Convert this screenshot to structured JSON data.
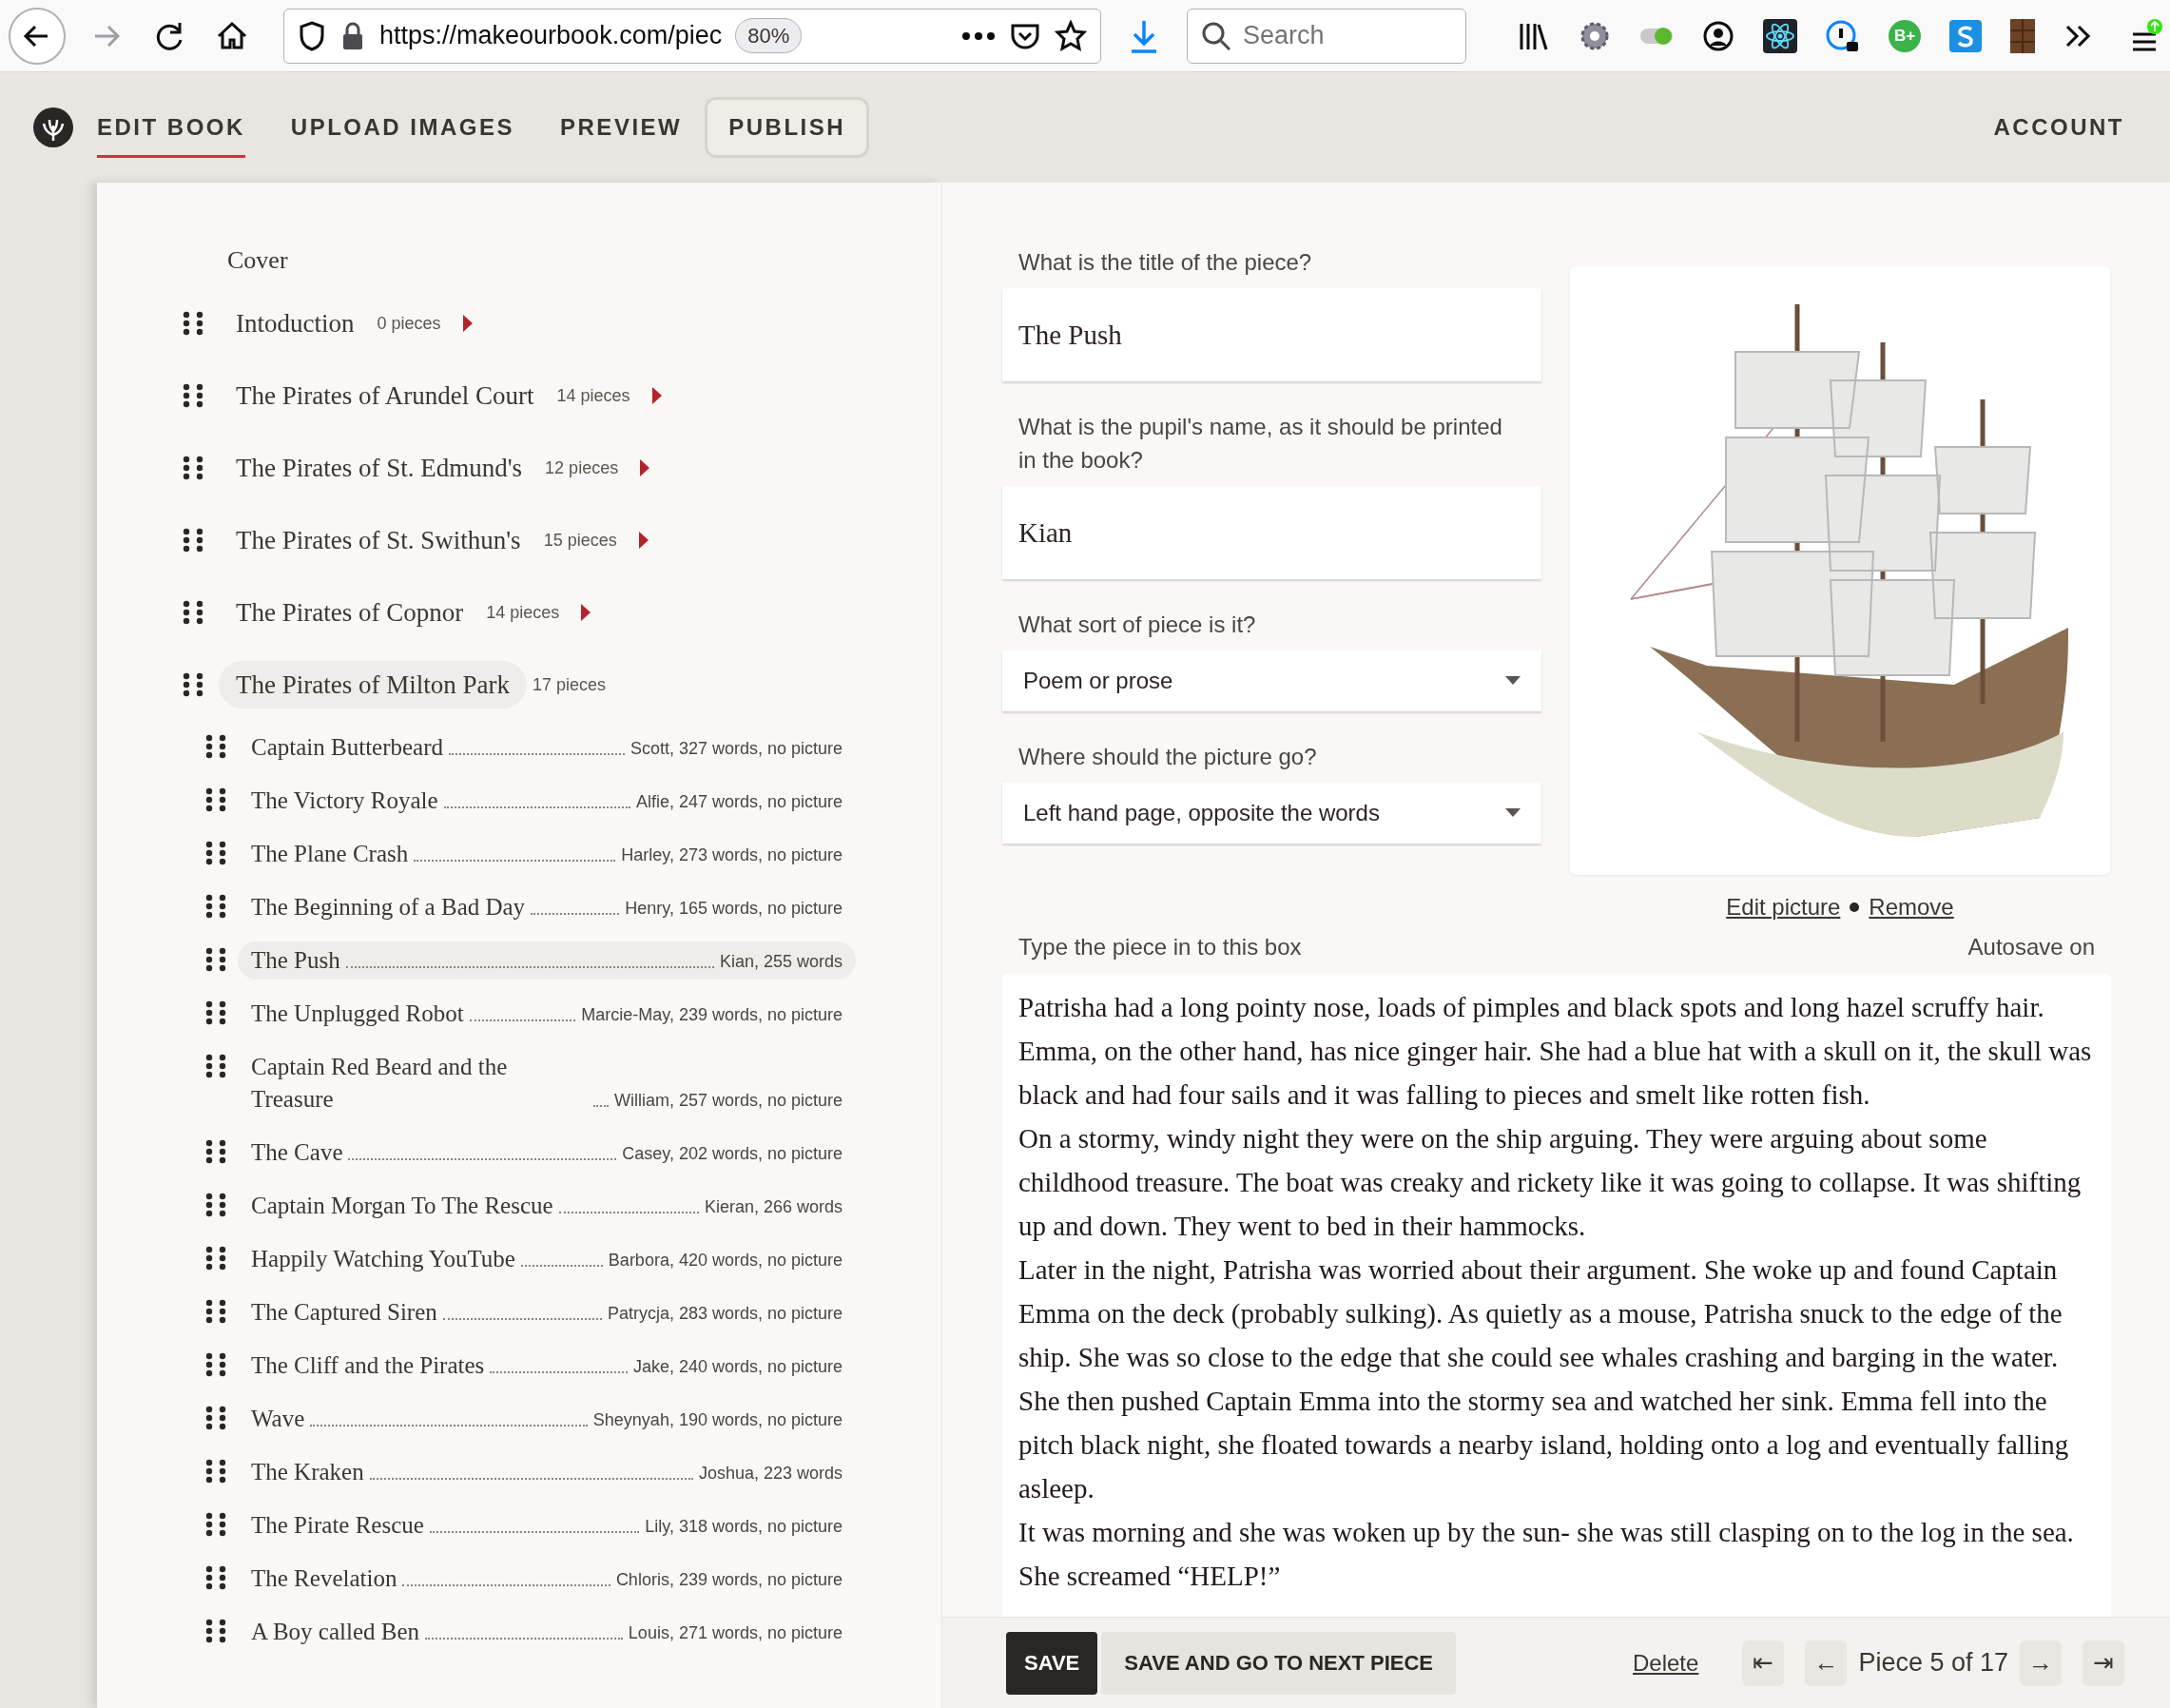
{
  "browser": {
    "url": "https://makeourbook.com/piec",
    "zoom": "80%",
    "search_placeholder": "Search",
    "extension_badge": "B+"
  },
  "nav": {
    "tabs": [
      {
        "label": "EDIT BOOK",
        "kind": "tab",
        "selected": true
      },
      {
        "label": "UPLOAD IMAGES",
        "kind": "tab",
        "selected": false
      },
      {
        "label": "PREVIEW",
        "kind": "tab",
        "selected": false
      },
      {
        "label": "PUBLISH",
        "kind": "button",
        "selected": false
      }
    ],
    "account": "ACCOUNT"
  },
  "contents": [
    {
      "kind": "cover",
      "title": "Cover"
    },
    {
      "kind": "chapter",
      "title": "Intoduction",
      "count": "0 pieces",
      "expanded": false,
      "selected": false
    },
    {
      "kind": "chapter",
      "title": "The Pirates of Arundel Court",
      "count": "14 pieces",
      "expanded": false,
      "selected": false
    },
    {
      "kind": "chapter",
      "title": "The Pirates of St. Edmund's",
      "count": "12 pieces",
      "expanded": false,
      "selected": false
    },
    {
      "kind": "chapter",
      "title": "The Pirates of St. Swithun's",
      "count": "15 pieces",
      "expanded": false,
      "selected": false
    },
    {
      "kind": "chapter",
      "title": "The Pirates of Copnor",
      "count": "14 pieces",
      "expanded": false,
      "selected": false
    },
    {
      "kind": "chapter",
      "title": "The Pirates of Milton Park",
      "count": "17 pieces",
      "expanded": true,
      "selected": true,
      "children": [
        {
          "title": "Captain Butterbeard",
          "meta": "Scott, 327 words, no picture",
          "selected": false
        },
        {
          "title": "The Victory Royale",
          "meta": "Alfie, 247 words, no picture",
          "selected": false
        },
        {
          "title": "The Plane Crash",
          "meta": "Harley, 273 words, no picture",
          "selected": false
        },
        {
          "title": "The Beginning of a Bad Day",
          "meta": "Henry, 165 words, no picture",
          "selected": false
        },
        {
          "title": "The Push",
          "meta": "Kian, 255 words",
          "selected": true
        },
        {
          "title": "The Unplugged Robot",
          "meta": "Marcie-May, 239 words, no picture",
          "selected": false
        },
        {
          "title": "Captain Red Beard and the Treasure",
          "meta": "William, 257 words, no picture",
          "selected": false
        },
        {
          "title": "The Cave",
          "meta": "Casey, 202 words, no picture",
          "selected": false
        },
        {
          "title": "Captain Morgan To The Rescue",
          "meta": "Kieran, 266 words",
          "selected": false
        },
        {
          "title": "Happily Watching YouTube",
          "meta": "Barbora, 420 words, no picture",
          "selected": false
        },
        {
          "title": "The Captured Siren",
          "meta": "Patrycja, 283 words, no picture",
          "selected": false
        },
        {
          "title": "The Cliff and the Pirates",
          "meta": "Jake, 240 words, no picture",
          "selected": false
        },
        {
          "title": "Wave",
          "meta": "Sheynyah, 190 words, no picture",
          "selected": false
        },
        {
          "title": "The Kraken",
          "meta": "Joshua, 223 words",
          "selected": false
        },
        {
          "title": "The Pirate Rescue",
          "meta": "Lily, 318 words, no picture",
          "selected": false
        },
        {
          "title": "The Revelation",
          "meta": "Chloris, 239 words, no picture",
          "selected": false
        },
        {
          "title": "A Boy called Ben",
          "meta": "Louis, 271 words, no picture",
          "selected": false
        }
      ]
    }
  ],
  "form": {
    "fields": [
      {
        "kind": "text",
        "label": "What is the title of the piece?",
        "value": "The Push"
      },
      {
        "kind": "text",
        "label": "What is the pupil's name, as it should be printed in the book?",
        "value": "Kian"
      },
      {
        "kind": "select",
        "label": "What sort of piece is it?",
        "value": "Poem or prose"
      },
      {
        "kind": "select",
        "label": "Where should the picture go?",
        "value": "Left hand page, opposite the words"
      }
    ],
    "picture_links": [
      "Edit picture",
      "Remove"
    ],
    "text_label": "Type the piece in to this box",
    "autosave": "Autosave on",
    "text": [
      "Patrisha had a long pointy nose, loads of pimples and black spots and long hazel scruffy hair. Emma, on the other hand, has nice ginger hair. She had a blue hat with a skull on it, the skull was black and had four sails and it was falling to pieces and smelt like rotten fish.",
      "On a stormy, windy night they were on the ship arguing. They were arguing about some childhood treasure. The boat was creaky and rickety like it was going to collapse. It was shifting up and down. They went to bed in their hammocks.",
      "Later in the night, Patrisha was worried about their argument. She woke up and found Captain Emma on the deck (probably sulking). As quietly as a mouse, Patrisha snuck to the edge of the ship. She was so close to the edge that she could see whales crashing and barging in the water. She then pushed Captain Emma into the stormy sea and watched her sink.  Emma fell into the pitch black night, she floated towards a nearby island, holding onto a log and eventually falling asleep.",
      "It was morning and she was woken up by the sun- she was still clasping on to the log in the sea. She screamed “HELP!”"
    ]
  },
  "footer": {
    "save": "SAVE",
    "save_next": "SAVE AND GO TO NEXT PIECE",
    "delete": "Delete",
    "first": "⇤",
    "prev": "←",
    "position": "Piece 5 of 17",
    "next": "→",
    "last": "⇥"
  }
}
